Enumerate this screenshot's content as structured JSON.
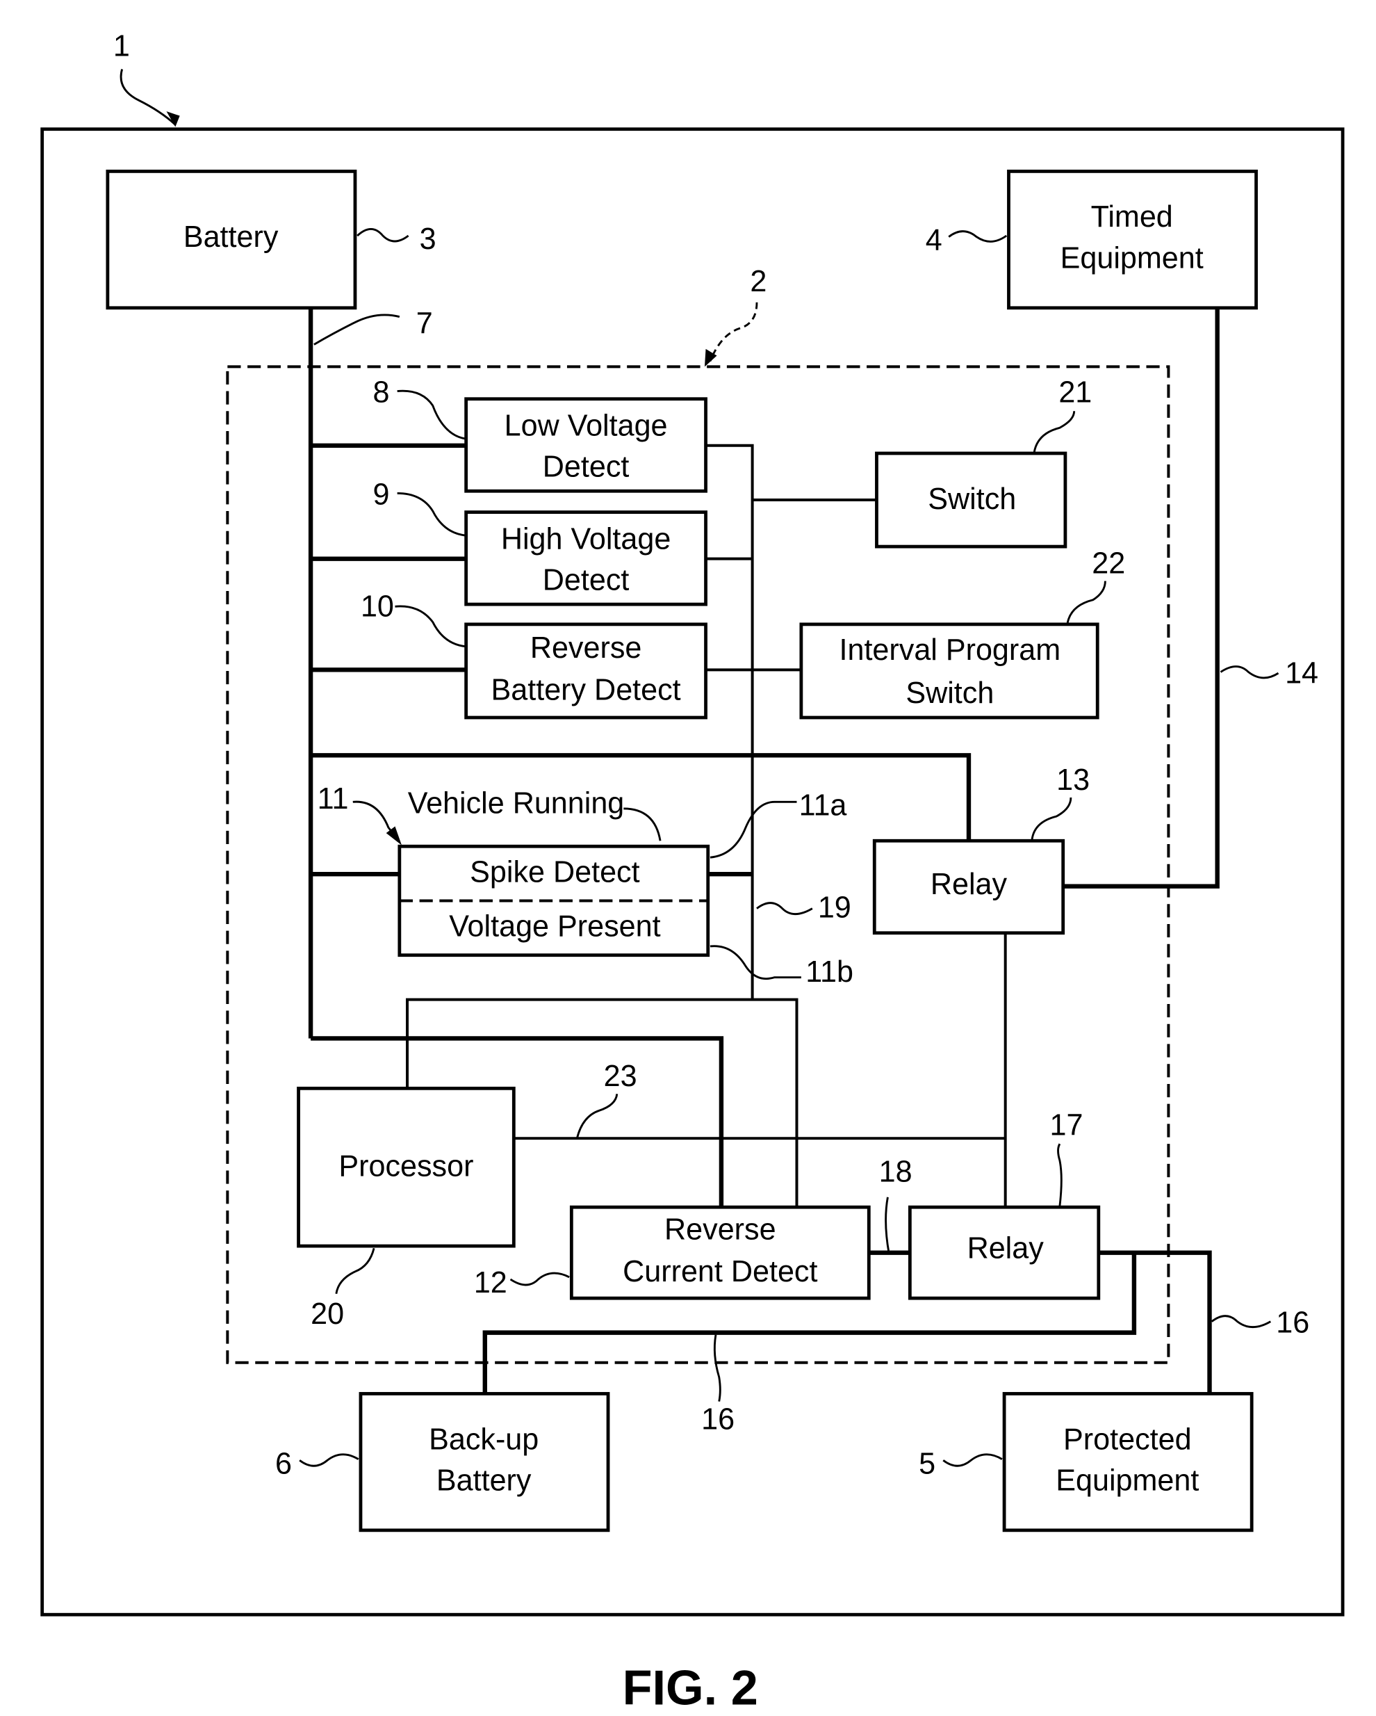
{
  "figure": {
    "caption": "FIG. 2"
  },
  "blocks": {
    "battery": {
      "line1": "Battery",
      "ref": "3"
    },
    "timed_equipment": {
      "line1": "Timed",
      "line2": "Equipment",
      "ref": "4"
    },
    "low_voltage_detect": {
      "line1": "Low Voltage",
      "line2": "Detect",
      "ref": "8"
    },
    "high_voltage_detect": {
      "line1": "High Voltage",
      "line2": "Detect",
      "ref": "9"
    },
    "reverse_battery_detect": {
      "line1": "Reverse",
      "line2": "Battery Detect",
      "ref": "10"
    },
    "switch": {
      "line1": "Switch",
      "ref": "21"
    },
    "interval_program_switch": {
      "line1": "Interval Program",
      "line2": "Switch",
      "ref": "22"
    },
    "vehicle_running": {
      "title": "Vehicle Running",
      "ref": "11",
      "spike": "Spike Detect",
      "spike_ref": "11a",
      "voltage": "Voltage Present",
      "voltage_ref": "11b"
    },
    "relay_13": {
      "line1": "Relay",
      "ref": "13"
    },
    "processor": {
      "line1": "Processor",
      "ref": "20"
    },
    "reverse_current_detect": {
      "line1": "Reverse",
      "line2": "Current Detect",
      "ref": "12"
    },
    "relay_17": {
      "line1": "Relay",
      "ref": "17"
    },
    "backup_battery": {
      "line1": "Back-up",
      "line2": "Battery",
      "ref": "6"
    },
    "protected_equipment": {
      "line1": "Protected",
      "line2": "Equipment",
      "ref": "5"
    }
  },
  "refs": {
    "system": "1",
    "controller": "2",
    "line_7": "7",
    "line_14": "14",
    "line_16a": "16",
    "line_16b": "16",
    "line_18": "18",
    "line_19": "19",
    "line_23": "23"
  }
}
